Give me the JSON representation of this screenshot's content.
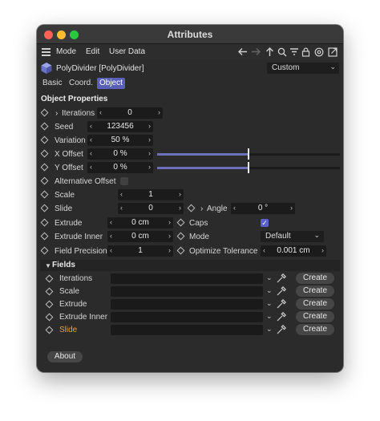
{
  "window": {
    "title": "Attributes"
  },
  "menu": {
    "mode": "Mode",
    "edit": "Edit",
    "user_data": "User Data"
  },
  "object": {
    "name": "PolyDivider [PolyDivider]",
    "preset": "Custom"
  },
  "tabs": [
    "Basic",
    "Coord.",
    "Object"
  ],
  "active_tab": "Object",
  "section": {
    "title": "Object Properties"
  },
  "props": {
    "iterations": {
      "label": "Iterations",
      "value": "0"
    },
    "seed": {
      "label": "Seed",
      "value": "123456"
    },
    "variation": {
      "label": "Variation",
      "value": "50 %"
    },
    "x_offset": {
      "label": "X Offset",
      "value": "0 %",
      "slider_fraction": 0.5
    },
    "y_offset": {
      "label": "Y Offset",
      "value": "0 %",
      "slider_fraction": 0.5
    },
    "alt_offset": {
      "label": "Alternative Offset",
      "checked": false
    },
    "scale": {
      "label": "Scale",
      "value": "1"
    },
    "slide": {
      "label": "Slide",
      "value": "0"
    },
    "angle": {
      "label": "Angle",
      "value": "0 °"
    },
    "extrude": {
      "label": "Extrude",
      "value": "0 cm"
    },
    "caps": {
      "label": "Caps",
      "checked": true
    },
    "extrude_inner": {
      "label": "Extrude Inner",
      "value": "0 cm"
    },
    "mode": {
      "label": "Mode",
      "value": "Default"
    },
    "field_precision": {
      "label": "Field Precision",
      "value": "1"
    },
    "optimize_tolerance": {
      "label": "Optimize Tolerance",
      "value": "0.001 cm"
    }
  },
  "fields_section": {
    "title": "Fields"
  },
  "fields": [
    {
      "label": "Iterations",
      "button": "Create"
    },
    {
      "label": "Scale",
      "button": "Create"
    },
    {
      "label": "Extrude",
      "button": "Create"
    },
    {
      "label": "Extrude Inner",
      "button": "Create"
    },
    {
      "label": "Slide",
      "button": "Create",
      "highlight": "#f0a030"
    }
  ],
  "about": "About",
  "icons": {
    "menu": "hamburger-icon",
    "back": "arrow-left-icon",
    "forward": "arrow-right-icon",
    "up": "arrow-up-icon",
    "search": "search-icon",
    "filter": "filter-icon",
    "lock": "lock-icon",
    "target": "target-icon",
    "new_window": "new-window-icon",
    "pipette": "pipette-icon"
  },
  "colors": {
    "accent": "#5a60b8",
    "slider": "#6b70b8",
    "highlight": "#f0a030"
  }
}
